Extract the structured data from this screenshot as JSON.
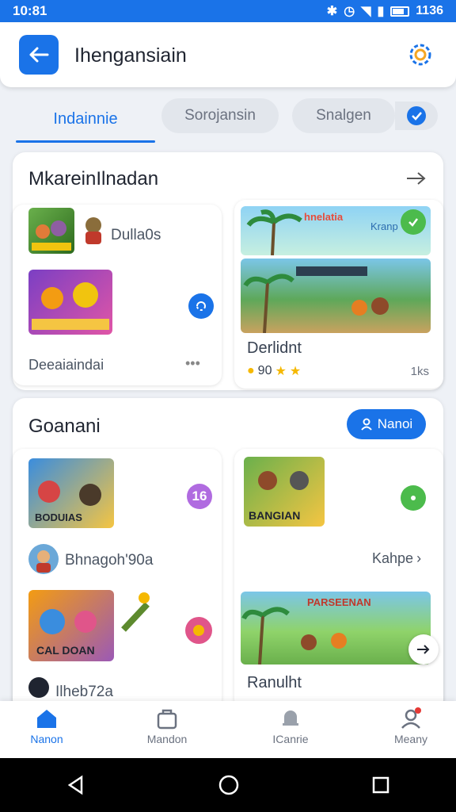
{
  "status_bar": {
    "time": "10:81",
    "right_time": "1136"
  },
  "app_bar": {
    "title": "Ihengansiain"
  },
  "tabs": {
    "active": "Indainnie",
    "pill_one": "Sorojansin",
    "pill_two": "Snalgen"
  },
  "section1": {
    "title": "MkareinIlnadan",
    "item1_label": "Dulla0s",
    "item2_label": "Deeaiaindai",
    "more": "•••",
    "featured": {
      "banner_text": "hnelatia",
      "banner_tag": "Kranp",
      "title": "Derlidnt",
      "rating": "90",
      "meta": "1ks"
    }
  },
  "section2": {
    "title": "Goanani",
    "cta_label": "Nanoi",
    "left_card": {
      "badge": "16",
      "item1_label": "Bhnagoh'90a",
      "item2_label": "Ilheb72a",
      "thumb1_text": "BODUIAS",
      "thumb2_text": "CAL DOAN"
    },
    "right_card": {
      "thumb1_text": "BANGIAN",
      "link_label": "Kahpe",
      "banner_text": "PARSEENAN",
      "title": "Ranulht"
    }
  },
  "bottom_nav": [
    {
      "label": "Nanon",
      "icon": "home-icon"
    },
    {
      "label": "Mandon",
      "icon": "briefcase-icon"
    },
    {
      "label": "ICanrie",
      "icon": "bell-icon"
    },
    {
      "label": "Meany",
      "icon": "profile-icon"
    }
  ],
  "colors": {
    "primary": "#1a73e8",
    "badge_purple": "#b06be0",
    "badge_green": "#4cbb4c"
  }
}
